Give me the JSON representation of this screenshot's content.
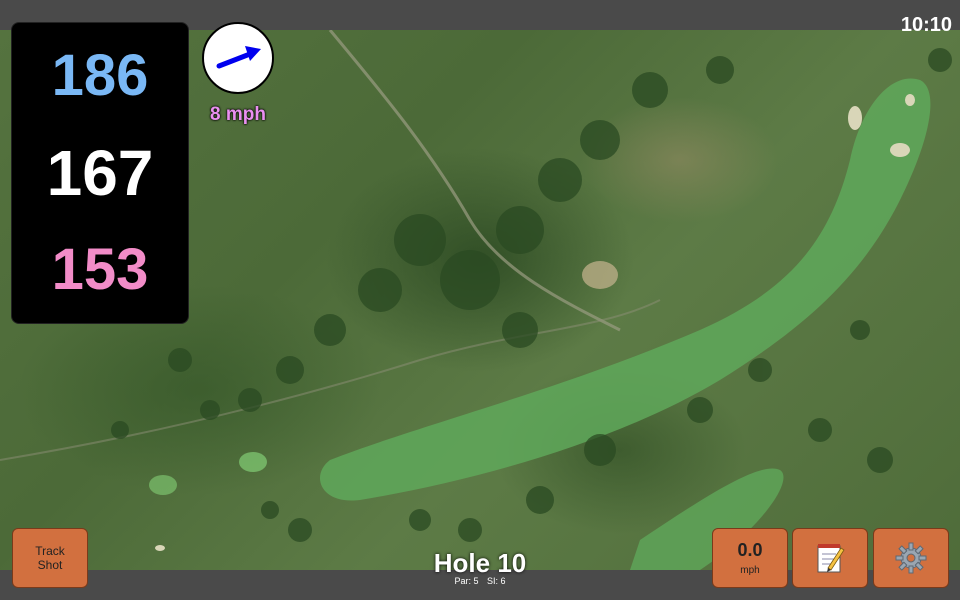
{
  "status": {
    "time": "10:10"
  },
  "distances": {
    "back": "186",
    "middle": "167",
    "front": "153"
  },
  "wind": {
    "speed": "8 mph",
    "direction_icon": "arrow-up-right-icon"
  },
  "hole": {
    "title": "Hole 10",
    "par": "Par: 5",
    "stroke_index": "SI: 6"
  },
  "buttons": {
    "track_shot_line1": "Track",
    "track_shot_line2": "Shot",
    "speed_value": "0.0",
    "speed_unit": "mph",
    "notes_icon": "notepad-icon",
    "settings_icon": "gear-icon"
  },
  "colors": {
    "back_distance": "#7ab8f5",
    "middle_distance": "#ffffff",
    "front_distance": "#f28cc8",
    "wind_text": "#ea8ff0",
    "button_bg": "#d2703f",
    "fairway": "#5fa85a"
  }
}
